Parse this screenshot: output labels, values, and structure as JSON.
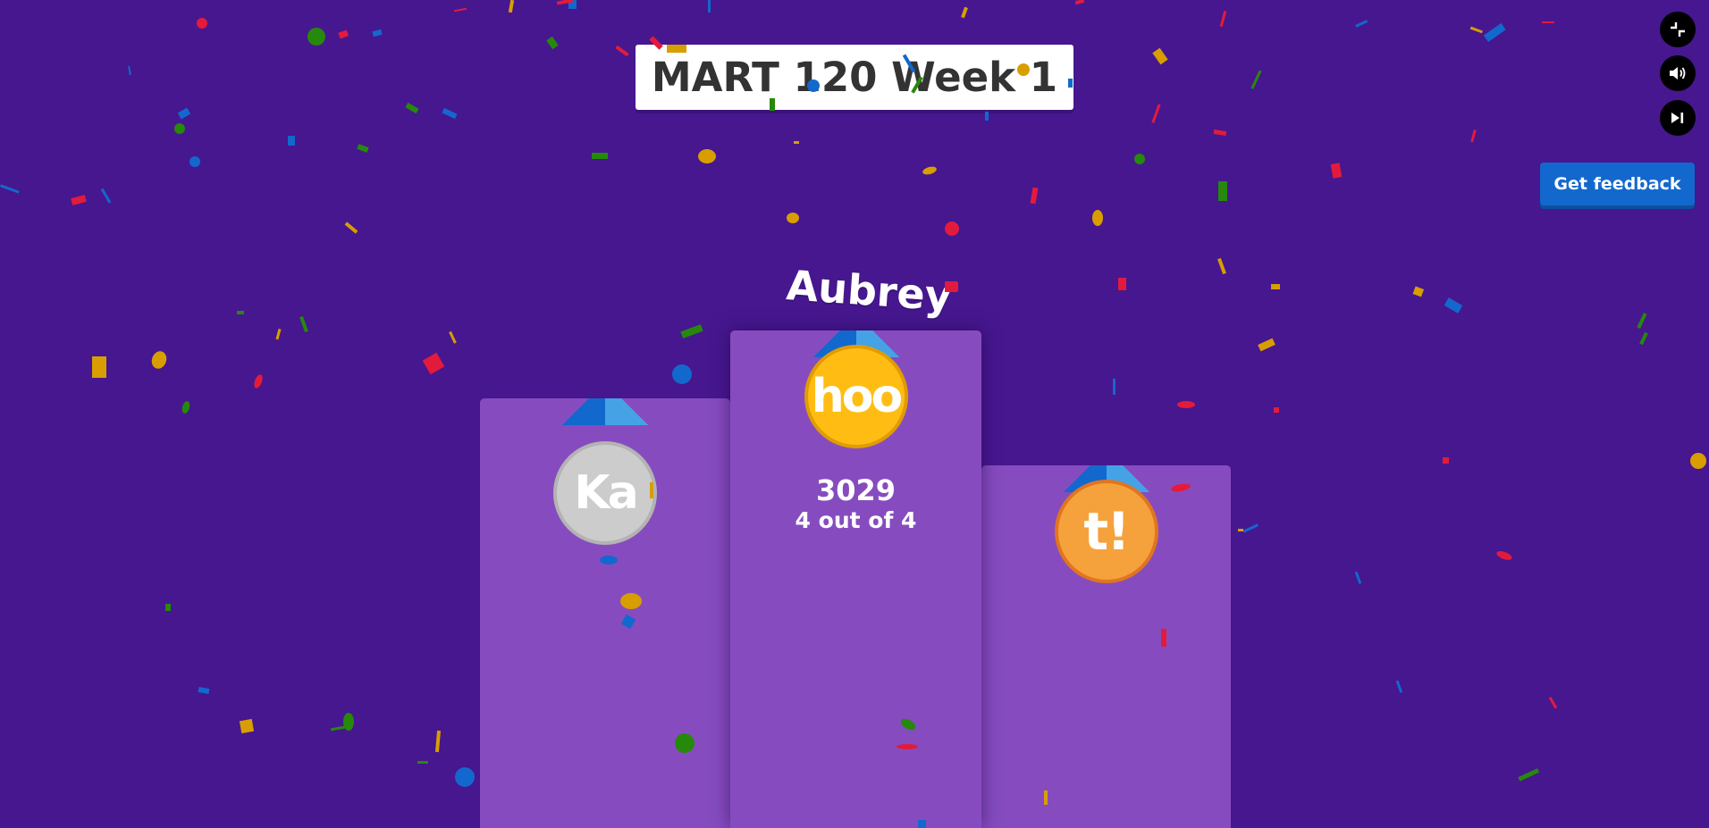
{
  "quiz": {
    "title": "MART 120 Week 1"
  },
  "controls": {
    "fullscreen_icon": "fullscreen-exit-icon",
    "sound_icon": "sound-on-icon",
    "skip_icon": "skip-next-icon",
    "feedback_label": "Get feedback"
  },
  "podium": {
    "first": {
      "name": "Aubrey",
      "medal_text": "hoo",
      "medal_color": "#ffbd14",
      "points": "3029",
      "correct": "4 out of 4"
    },
    "second": {
      "medal_text": "Ka",
      "medal_color": "#cccccc"
    },
    "third": {
      "medal_text": "t!",
      "medal_color": "#f5a23d"
    }
  },
  "colors": {
    "background": "#46178f",
    "podium": "#864cbf",
    "button": "#1368ce",
    "confetti": [
      "#e21b3c",
      "#1368ce",
      "#d89e00",
      "#26890c"
    ]
  }
}
